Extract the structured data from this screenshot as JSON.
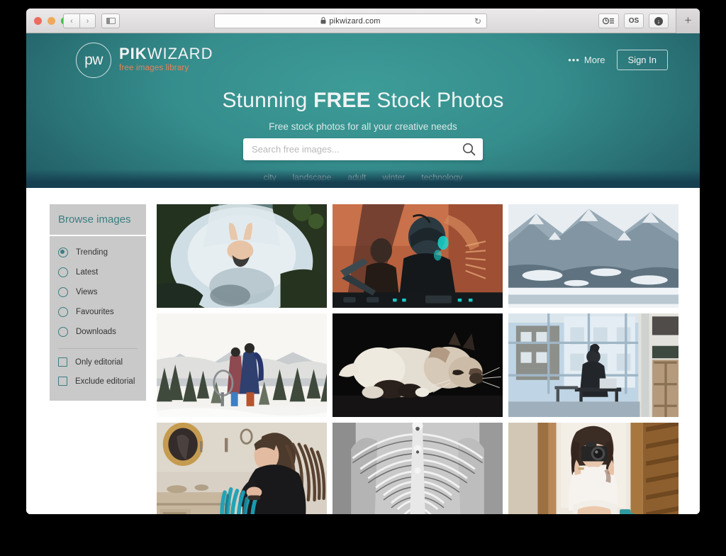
{
  "browser": {
    "traffic_lights": [
      "close",
      "minimize",
      "maximize"
    ],
    "back_label": "‹",
    "forward_label": "›",
    "sidebar_toggle_name": "sidebar-toggle",
    "url": "pikwizard.com",
    "lock_glyph": "🔒",
    "reload_glyph": "↻",
    "toolbar_buttons": [
      {
        "name": "reading-list-icon",
        "label": "⊙≡"
      },
      {
        "name": "os-extension-button",
        "label": "OS"
      },
      {
        "name": "download-icon",
        "label": "↓"
      }
    ],
    "new_tab_label": "+"
  },
  "hero": {
    "logo": {
      "mark": "pw",
      "name_bold": "PIK",
      "name_light": "WIZARD",
      "tagline": "free images library"
    },
    "more_label": "More",
    "more_dots": "•••",
    "signin_label": "Sign In",
    "headline_pre": "Stunning ",
    "headline_bold": "FREE",
    "headline_post": " Stock Photos",
    "subheadline": "Free stock photos for all your creative needs",
    "search": {
      "placeholder": "Search free images...",
      "value": "",
      "icon": "search-icon"
    },
    "tags": [
      "city",
      "landscape",
      "adult",
      "winter",
      "technology"
    ],
    "colors": {
      "teal_center": "#3d9c98",
      "teal_edge": "#1b4e5b",
      "accent_orange": "#e8825a"
    }
  },
  "sidebar": {
    "title": "Browse images",
    "radios": [
      {
        "label": "Trending",
        "selected": true
      },
      {
        "label": "Latest",
        "selected": false
      },
      {
        "label": "Views",
        "selected": false
      },
      {
        "label": "Favourites",
        "selected": false
      },
      {
        "label": "Downloads",
        "selected": false
      }
    ],
    "checkboxes": [
      {
        "label": "Only editorial",
        "checked": false
      },
      {
        "label": "Exclude editorial",
        "checked": false
      }
    ],
    "accent": "#3b7e81",
    "panel_bg": "#c9c9c9"
  },
  "gallery": {
    "items": [
      {
        "name": "photo-waterfall-swimmer",
        "alt": "Person bathing under a forest waterfall"
      },
      {
        "name": "photo-dj-performance",
        "alt": "DJ performing behind decks in orange and teal light"
      },
      {
        "name": "photo-snowy-mountains",
        "alt": "Snow covered mountain range over a lake"
      },
      {
        "name": "photo-snowboarders",
        "alt": "Two snowboarders on a mountain ridge with pine trees"
      },
      {
        "name": "photo-sleeping-cat",
        "alt": "Siamese cat sleeping on a black background"
      },
      {
        "name": "photo-woman-at-window",
        "alt": "Woman working at a desk beside large office windows"
      },
      {
        "name": "photo-woman-dreadlocks",
        "alt": "Woman with blue dreadlocks in a room with a mirror"
      },
      {
        "name": "photo-gothic-arches",
        "alt": "Black and white gothic vaulted ceiling arcade"
      },
      {
        "name": "photo-woman-with-camera",
        "alt": "Woman holding a camera in a wooden room"
      }
    ]
  }
}
